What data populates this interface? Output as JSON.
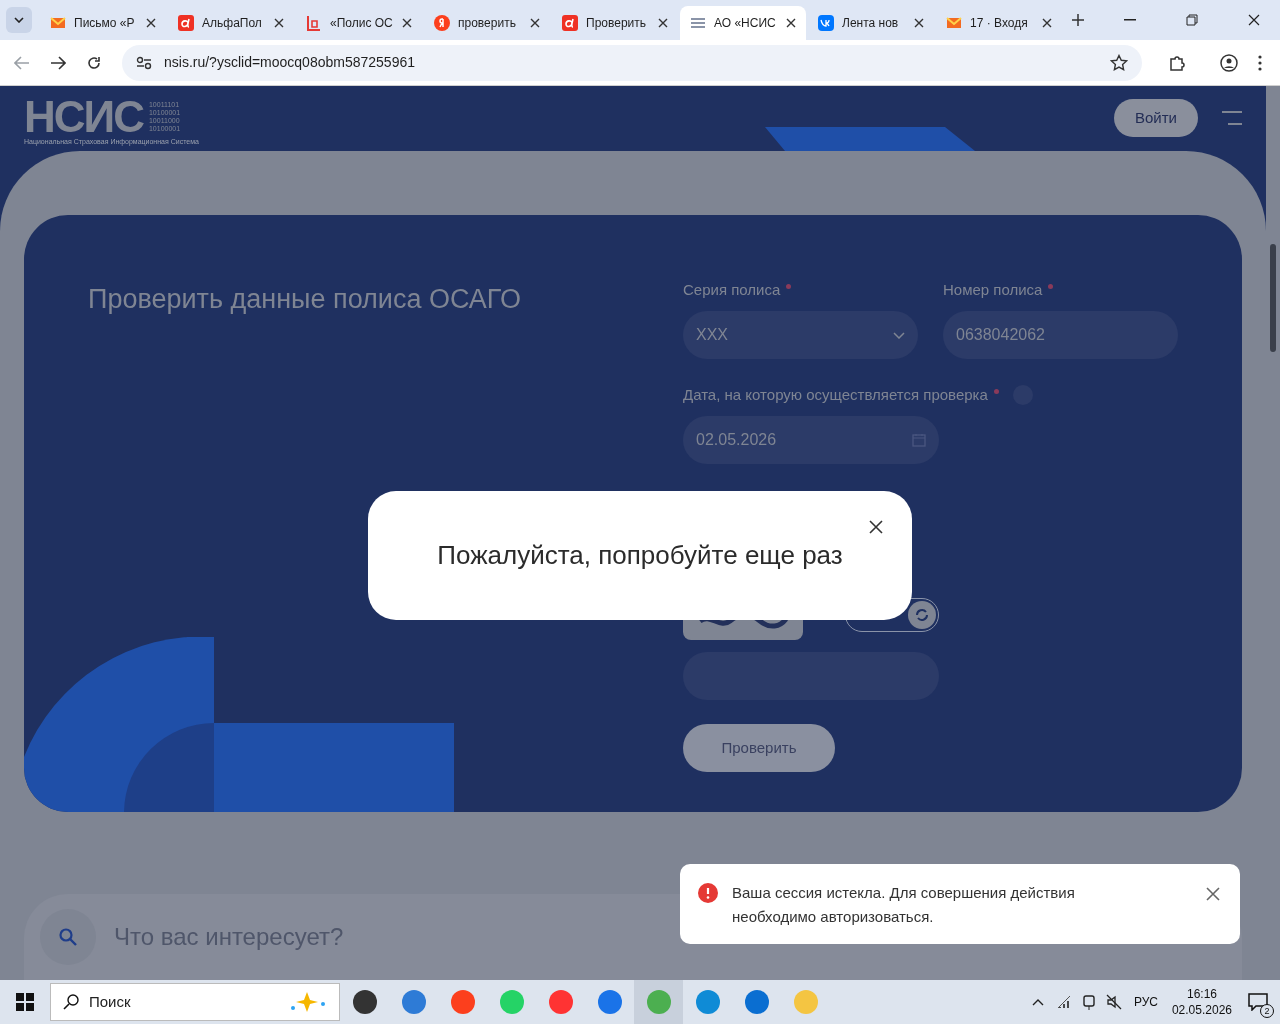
{
  "browser": {
    "tabs": [
      {
        "title": "Письмо «Р",
        "selected": false
      },
      {
        "title": "АльфаПол",
        "selected": false
      },
      {
        "title": "«Полис ОС",
        "selected": false
      },
      {
        "title": "проверить",
        "selected": false
      },
      {
        "title": "Проверить",
        "selected": false
      },
      {
        "title": "АО «НСИС",
        "selected": true
      },
      {
        "title": "Лента нов",
        "selected": false
      },
      {
        "title": "17 · Входя",
        "selected": false
      }
    ],
    "url": "nsis.ru/?ysclid=moocq08obm587255961"
  },
  "page": {
    "logo": {
      "wordmark": "НСИС",
      "binary": [
        "10011101",
        "10100001",
        "10011000",
        "10100001"
      ],
      "tagline": "Национальная Страховая Информационная Система"
    },
    "login_button": "Войти",
    "form": {
      "title": "Проверить данные полиса ОСАГО",
      "fields": [
        {
          "kind": "select",
          "label": "Серия полиса",
          "required": true,
          "value": "XXX"
        },
        {
          "kind": "text",
          "label": "Номер полиса",
          "required": true,
          "value": "0638042062"
        },
        {
          "kind": "date",
          "label": "Дата, на которую осуществляется проверка",
          "required": true,
          "help": true,
          "value": "02.05.2026"
        }
      ],
      "submit": "Проверить"
    },
    "search": {
      "placeholder": "Что вас интересует?"
    },
    "modal": {
      "message": "Пожалуйста, попробуйте еще раз"
    },
    "toast": {
      "message": "Ваша сессия истекла. Для совершения действия необходимо авторизоваться."
    }
  },
  "taskbar": {
    "search": "Поиск",
    "language": "РУС",
    "time": "16:16",
    "date": "02.05.2026",
    "notifications": "2"
  }
}
